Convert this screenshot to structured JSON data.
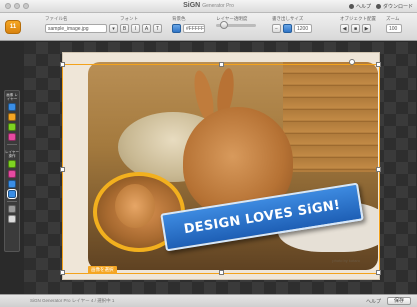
{
  "window": {
    "title": "SiGN",
    "subtitle": "Generator Pro",
    "links": [
      "ヘルプ",
      "ダウンロード"
    ]
  },
  "toolbar": {
    "logo": "11",
    "groups": [
      {
        "label": "ファイル名",
        "value": "sample_image.jpg"
      },
      {
        "label": "フォント",
        "value": "A"
      },
      {
        "label": "背景色",
        "value": "#FFFFFF"
      },
      {
        "label": "レイヤー透明度",
        "value": "100"
      },
      {
        "label": "書き出しサイズ",
        "value": "1200"
      },
      {
        "label": "オブジェクト配置",
        "value": ""
      },
      {
        "label": "ズーム",
        "value": "100"
      }
    ]
  },
  "left_panel": {
    "section1": "画像\nレイヤー",
    "section2": "レイヤー\n操作",
    "button_colors": [
      "#3a8ee6",
      "#f5a623",
      "#7ed321",
      "#e64aa0",
      "#7ed321",
      "#e64aa0",
      "#3a8ee6",
      "#9b9b9b",
      "#ffffff"
    ]
  },
  "design": {
    "banner_text": "DESIGN LOVES SiGN!",
    "credit": "photo by kotaro",
    "selection_tag": "画像を選択"
  },
  "status": {
    "left": "SiGN Generator Pro  レイヤー 4 / 選択中 1",
    "link": "ヘルプ",
    "button": "保存"
  },
  "colors": {
    "accent": "#f5a623",
    "banner": "#2a74cf"
  }
}
